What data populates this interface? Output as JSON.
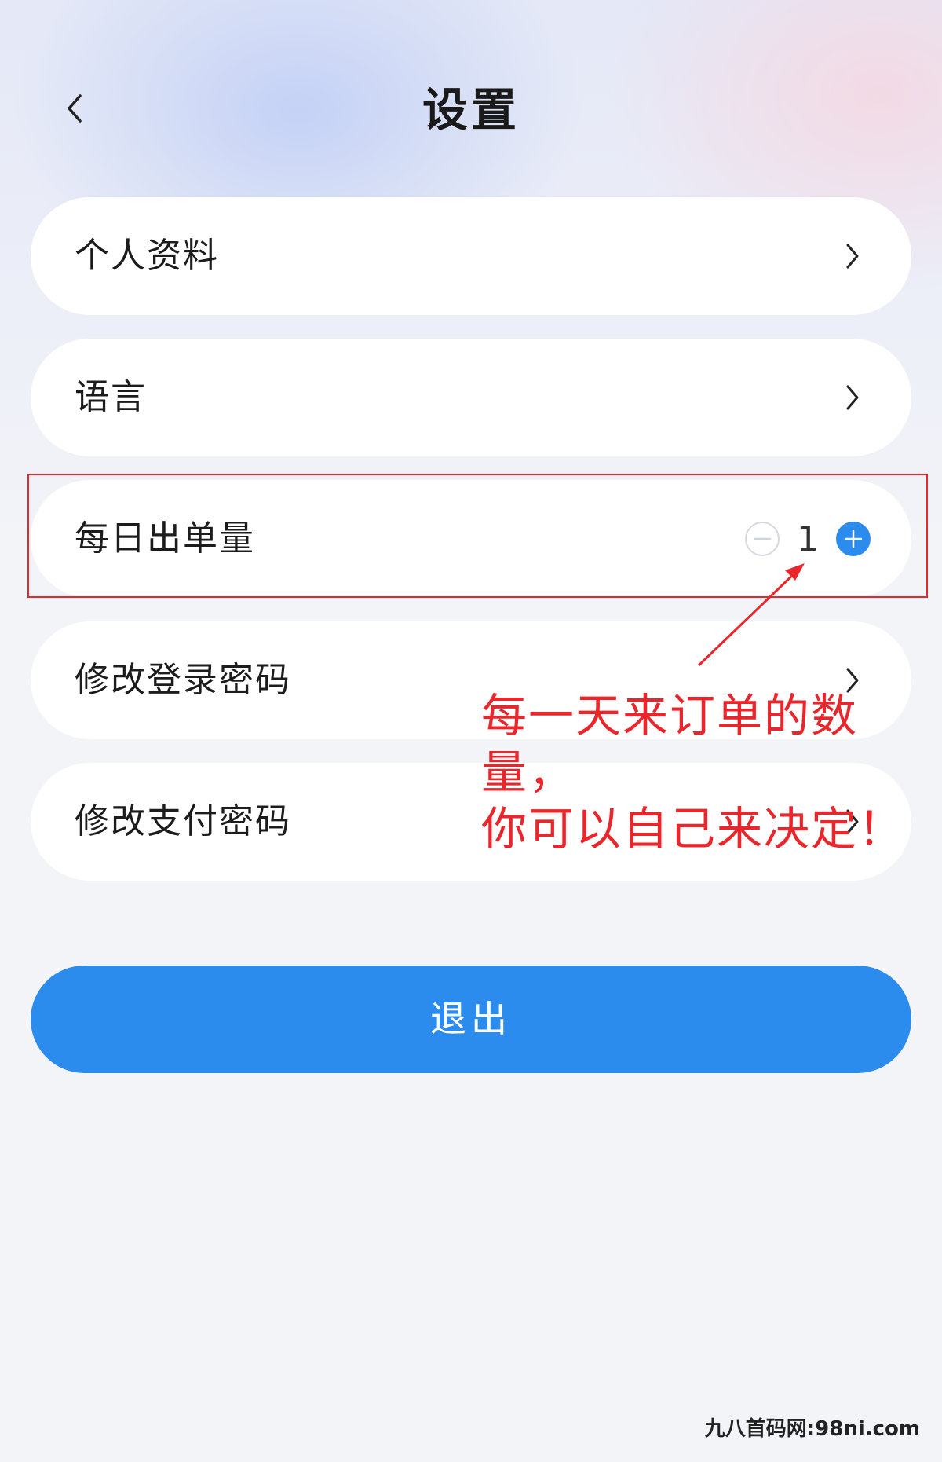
{
  "header": {
    "title": "设置"
  },
  "settings": {
    "profile_label": "个人资料",
    "language_label": "语言",
    "daily_orders_label": "每日出单量",
    "daily_orders_value": "1",
    "login_password_label": "修改登录密码",
    "pay_password_label": "修改支付密码"
  },
  "logout_label": "退出",
  "annotation": {
    "line1": "每一天来订单的数量，",
    "line2": "你可以自己来决定！"
  },
  "watermark": "九八首码网:98ni.com",
  "colors": {
    "accent": "#2b8cee",
    "annotation": "#e8262b",
    "background": "#f3f4f8"
  },
  "icons": [
    "back-chevron-icon",
    "chevron-right-icon",
    "minus-circle-icon",
    "plus-circle-icon"
  ]
}
